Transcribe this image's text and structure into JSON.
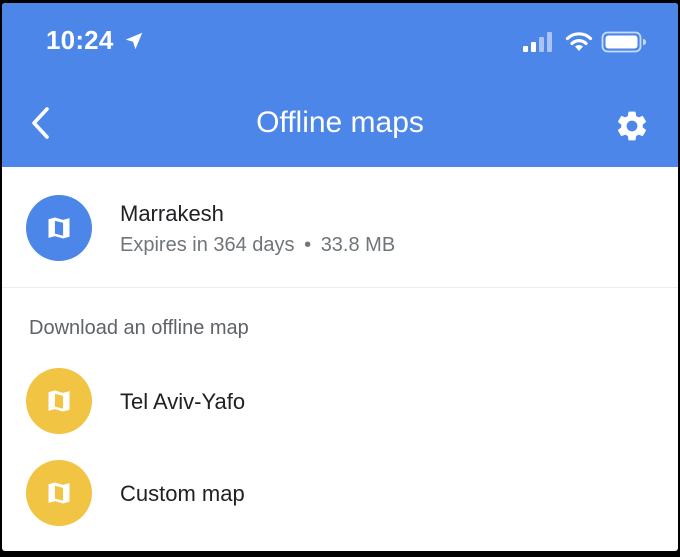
{
  "status_bar": {
    "time": "10:24",
    "icons": [
      "location-arrow-icon",
      "cellular-signal-icon",
      "wifi-icon",
      "battery-icon"
    ]
  },
  "nav": {
    "back_icon": "chevron-left-icon",
    "title": "Offline maps",
    "settings_icon": "gear-icon"
  },
  "downloaded_maps": [
    {
      "name": "Marrakesh",
      "expires": "Expires in 364 days",
      "separator": "•",
      "size": "33.8 MB",
      "icon": "map-icon",
      "icon_color": "#4c86e8"
    }
  ],
  "download_section": {
    "header": "Download an offline map",
    "items": [
      {
        "name": "Tel Aviv-Yafo",
        "icon": "map-icon",
        "icon_color": "#f2c443"
      },
      {
        "name": "Custom map",
        "icon": "map-icon",
        "icon_color": "#f2c443"
      }
    ]
  },
  "colors": {
    "header_bg": "#4c86e8",
    "accent_yellow": "#f2c443",
    "text_primary": "#202124",
    "text_secondary": "#70757a"
  }
}
